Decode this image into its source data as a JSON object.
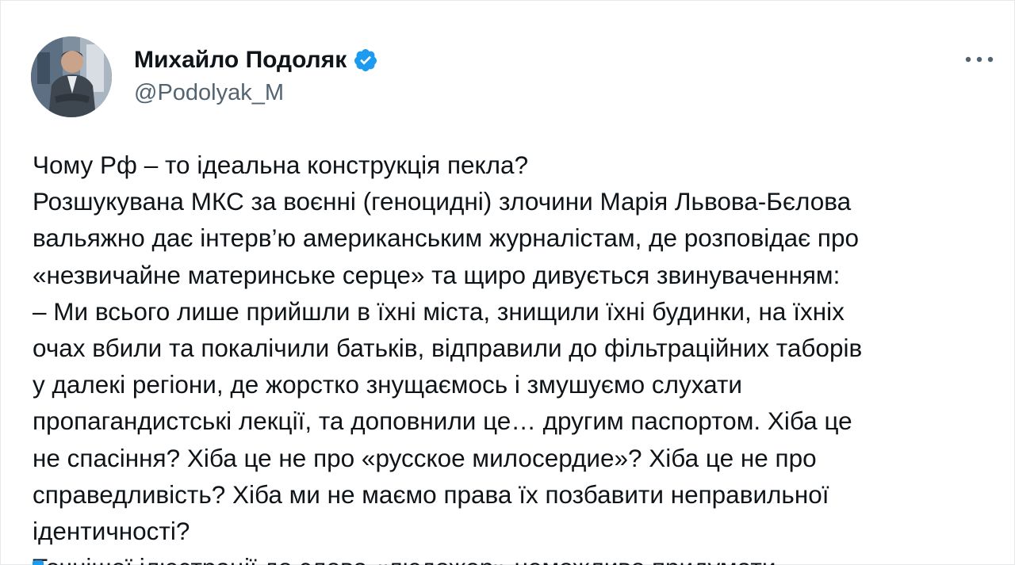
{
  "author": {
    "display_name": "Михайло Подоляк",
    "handle": "@Podolyak_M",
    "verified": true,
    "verified_color": "#1d9bf0",
    "avatar_icon": "profile-photo"
  },
  "menu": {
    "icon": "more-horizontal-icon"
  },
  "tweet": {
    "lines": [
      "Чому Рф – то ідеальна конструкція пекла?",
      "Розшукувана МКС за воєнні (геноцидні) злочини Марія Львова-Бєлова",
      "вальяжно дає інтерв’ю американським журналістам, де розповідає про",
      "«незвичайне материнське серце» та щиро дивується звинуваченням:",
      "– Ми всього лише прийшли в їхні міста, знищили їхні будинки, на їхніх",
      "очах вбили та покалічили батьків, відправили до фільтраційних таборів",
      "у далекі регіони, де жорстко знущаємось і змушуємо слухати",
      "пропагандистські лекції, та доповнили це… другим паспортом. Хіба це",
      "не спасіння? Хіба це не про «русское милосердие»? Хіба це не про",
      "справедливість? Хіба ми не маємо права їх позбавити неправильної",
      "ідентичності?",
      "Точнішої ілюстрації до слова «людожер» неможливо придумати…"
    ]
  },
  "colors": {
    "text": "#0f1419",
    "secondary": "#536471",
    "accent": "#1d9bf0"
  }
}
